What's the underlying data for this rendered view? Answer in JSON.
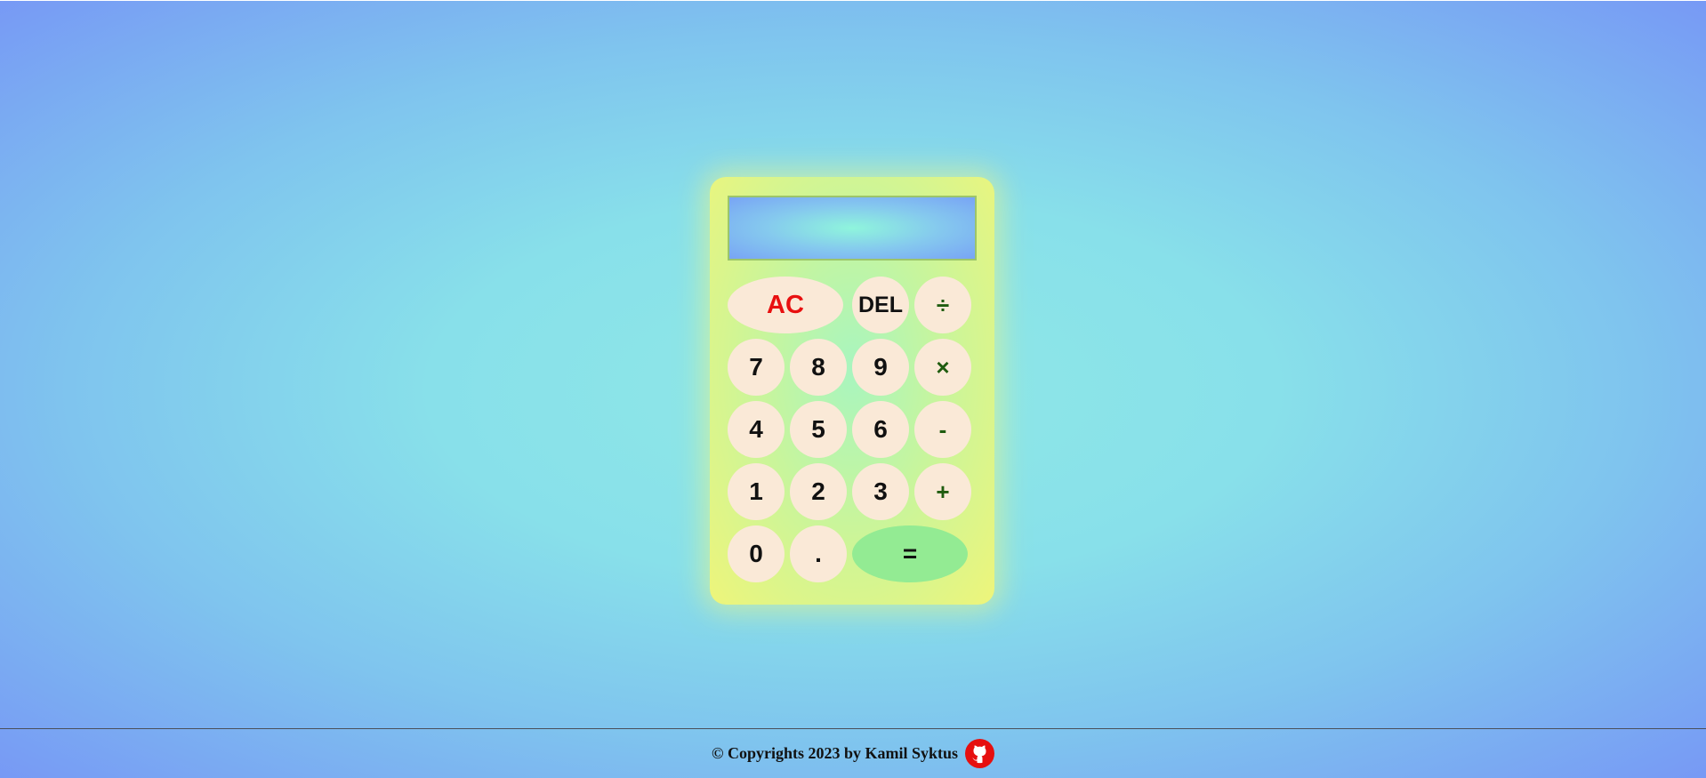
{
  "calculator": {
    "display_value": "",
    "keys": {
      "ac": "AC",
      "del": "DEL",
      "divide": "÷",
      "seven": "7",
      "eight": "8",
      "nine": "9",
      "multiply": "×",
      "four": "4",
      "five": "5",
      "six": "6",
      "subtract": "-",
      "one": "1",
      "two": "2",
      "three": "3",
      "add": "+",
      "zero": "0",
      "decimal": ".",
      "equals": "="
    }
  },
  "footer": {
    "copyright": "© Copyrights 2023 by Kamil Syktus",
    "icon": "github-icon"
  },
  "colors": {
    "ac_text": "#e81010",
    "operator_text": "#1f5c0f",
    "key_background": "#fae9d7",
    "equals_background": "#93eb93",
    "github_icon": "#e60f0f"
  }
}
